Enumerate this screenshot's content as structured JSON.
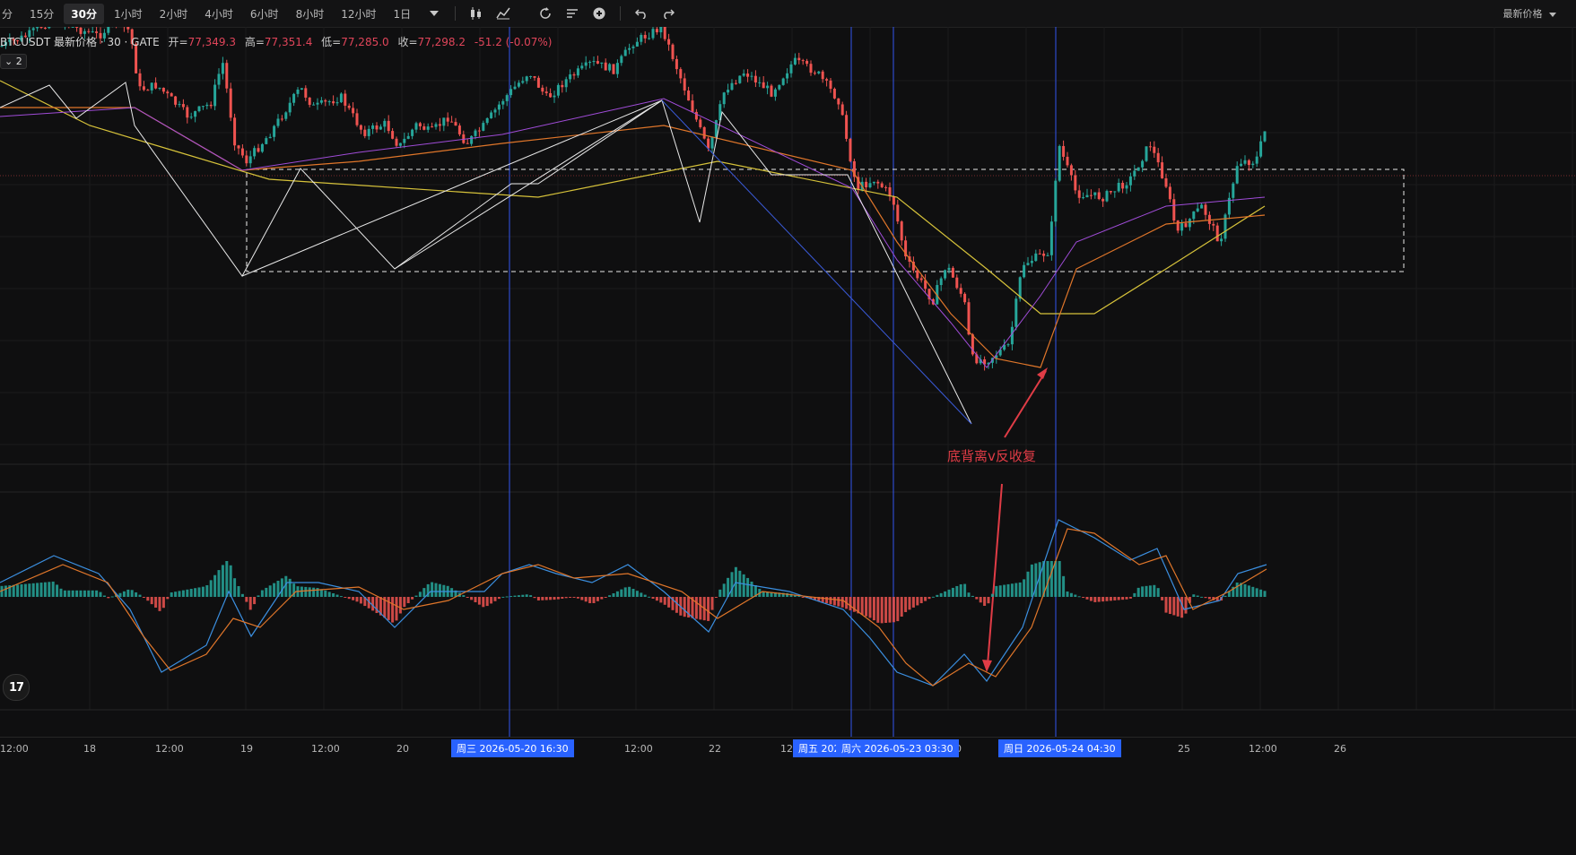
{
  "toolbar": {
    "timeframes": [
      "分",
      "15分",
      "30分",
      "1小时",
      "2小时",
      "4小时",
      "6小时",
      "8小时",
      "12小时",
      "1日"
    ],
    "active": "30分",
    "icons": [
      "chevron-down-icon",
      "candles-icon",
      "indicators-icon",
      "replay-icon",
      "alert-icon",
      "add-icon",
      "undo-icon",
      "redo-icon"
    ],
    "price_mode": "最新价格"
  },
  "legend": {
    "symbol": "BTCUSDT 最新价格 · 30 · GATE",
    "open_label": "开=",
    "open": "77,349.3",
    "high_label": "高=",
    "high": "77,351.4",
    "low_label": "低=",
    "low": "77,285.0",
    "close_label": "收=",
    "close": "77,298.2",
    "change": "-51.2 (-0.07%)",
    "collapse": "2"
  },
  "annotation": {
    "text": "底背离v反收复",
    "color": "#e03c46"
  },
  "time_axis": {
    "ticks": [
      "12:00",
      "18",
      "12:00",
      "19",
      "12:00",
      "20",
      "12:00",
      "22",
      "12",
      "00",
      "25",
      "12:00",
      "26"
    ],
    "highlights": [
      "周三 2026-05-20   16:30",
      "周五 202",
      "周六 2026-05-23   03:30",
      "周日 2026-05-24   04:30"
    ]
  },
  "colors": {
    "up": "#26a69a",
    "down": "#ef5350",
    "vline": "#3355ee",
    "ma_fast": "#a04cd8",
    "ma_mid": "#e0762a",
    "ma_slow": "#d6c23a",
    "macd": "#3b8fe0",
    "signal": "#e0762a"
  },
  "chart_data": {
    "type": "candlestick",
    "price_path": [
      [
        0,
        52
      ],
      [
        30,
        40
      ],
      [
        60,
        20
      ],
      [
        80,
        30
      ],
      [
        110,
        40
      ],
      [
        130,
        22
      ],
      [
        145,
        35
      ],
      [
        155,
        100
      ],
      [
        175,
        95
      ],
      [
        210,
        130
      ],
      [
        235,
        115
      ],
      [
        248,
        68
      ],
      [
        262,
        160
      ],
      [
        275,
        180
      ],
      [
        300,
        150
      ],
      [
        335,
        98
      ],
      [
        350,
        120
      ],
      [
        380,
        108
      ],
      [
        405,
        148
      ],
      [
        430,
        138
      ],
      [
        445,
        164
      ],
      [
        465,
        138
      ],
      [
        480,
        148
      ],
      [
        500,
        130
      ],
      [
        520,
        160
      ],
      [
        540,
        140
      ],
      [
        560,
        112
      ],
      [
        590,
        80
      ],
      [
        610,
        110
      ],
      [
        630,
        90
      ],
      [
        660,
        70
      ],
      [
        685,
        78
      ],
      [
        705,
        48
      ],
      [
        738,
        30
      ],
      [
        745,
        50
      ],
      [
        760,
        90
      ],
      [
        790,
        170
      ],
      [
        808,
        100
      ],
      [
        830,
        80
      ],
      [
        860,
        103
      ],
      [
        885,
        68
      ],
      [
        910,
        80
      ],
      [
        935,
        112
      ],
      [
        955,
        210
      ],
      [
        975,
        200
      ],
      [
        995,
        220
      ],
      [
        1010,
        290
      ],
      [
        1030,
        320
      ],
      [
        1040,
        336
      ],
      [
        1055,
        295
      ],
      [
        1075,
        335
      ],
      [
        1083,
        400
      ],
      [
        1100,
        402
      ],
      [
        1125,
        385
      ],
      [
        1140,
        295
      ],
      [
        1170,
        280
      ],
      [
        1180,
        160
      ],
      [
        1200,
        216
      ],
      [
        1230,
        220
      ],
      [
        1260,
        200
      ],
      [
        1282,
        160
      ],
      [
        1300,
        206
      ],
      [
        1312,
        260
      ],
      [
        1340,
        230
      ],
      [
        1360,
        270
      ],
      [
        1380,
        180
      ],
      [
        1400,
        180
      ],
      [
        1412,
        140
      ]
    ],
    "ma_fast": [
      [
        0,
        100
      ],
      [
        150,
        90
      ],
      [
        270,
        160
      ],
      [
        400,
        140
      ],
      [
        560,
        120
      ],
      [
        740,
        80
      ],
      [
        950,
        180
      ],
      [
        1000,
        260
      ],
      [
        1060,
        330
      ],
      [
        1100,
        380
      ],
      [
        1160,
        300
      ],
      [
        1200,
        240
      ],
      [
        1300,
        200
      ],
      [
        1410,
        190
      ]
    ],
    "ma_mid": [
      [
        0,
        90
      ],
      [
        150,
        90
      ],
      [
        270,
        160
      ],
      [
        400,
        150
      ],
      [
        560,
        130
      ],
      [
        740,
        110
      ],
      [
        950,
        160
      ],
      [
        1000,
        240
      ],
      [
        1060,
        320
      ],
      [
        1110,
        370
      ],
      [
        1160,
        380
      ],
      [
        1200,
        270
      ],
      [
        1300,
        220
      ],
      [
        1410,
        210
      ]
    ],
    "ma_slow": [
      [
        0,
        60
      ],
      [
        100,
        110
      ],
      [
        200,
        140
      ],
      [
        300,
        170
      ],
      [
        600,
        190
      ],
      [
        800,
        150
      ],
      [
        1000,
        190
      ],
      [
        1100,
        270
      ],
      [
        1160,
        320
      ],
      [
        1220,
        320
      ],
      [
        1300,
        270
      ],
      [
        1410,
        200
      ]
    ],
    "macd_line": [
      [
        0,
        650
      ],
      [
        60,
        620
      ],
      [
        110,
        640
      ],
      [
        145,
        680
      ],
      [
        180,
        750
      ],
      [
        230,
        720
      ],
      [
        255,
        660
      ],
      [
        280,
        710
      ],
      [
        320,
        650
      ],
      [
        355,
        650
      ],
      [
        400,
        660
      ],
      [
        440,
        700
      ],
      [
        480,
        660
      ],
      [
        540,
        660
      ],
      [
        560,
        640
      ],
      [
        590,
        630
      ],
      [
        620,
        640
      ],
      [
        660,
        650
      ],
      [
        700,
        630
      ],
      [
        740,
        660
      ],
      [
        790,
        705
      ],
      [
        820,
        650
      ],
      [
        880,
        660
      ],
      [
        940,
        680
      ],
      [
        970,
        712
      ],
      [
        1000,
        750
      ],
      [
        1040,
        765
      ],
      [
        1075,
        730
      ],
      [
        1100,
        760
      ],
      [
        1140,
        700
      ],
      [
        1180,
        580
      ],
      [
        1220,
        600
      ],
      [
        1260,
        625
      ],
      [
        1290,
        612
      ],
      [
        1320,
        680
      ],
      [
        1360,
        670
      ],
      [
        1380,
        640
      ],
      [
        1412,
        630
      ]
    ],
    "signal_line": [
      [
        0,
        660
      ],
      [
        70,
        630
      ],
      [
        120,
        650
      ],
      [
        160,
        710
      ],
      [
        190,
        748
      ],
      [
        230,
        730
      ],
      [
        260,
        690
      ],
      [
        290,
        700
      ],
      [
        330,
        660
      ],
      [
        400,
        655
      ],
      [
        450,
        680
      ],
      [
        500,
        670
      ],
      [
        560,
        640
      ],
      [
        600,
        630
      ],
      [
        640,
        645
      ],
      [
        700,
        640
      ],
      [
        760,
        660
      ],
      [
        800,
        690
      ],
      [
        850,
        660
      ],
      [
        940,
        670
      ],
      [
        980,
        700
      ],
      [
        1010,
        740
      ],
      [
        1040,
        765
      ],
      [
        1080,
        740
      ],
      [
        1110,
        755
      ],
      [
        1150,
        700
      ],
      [
        1190,
        590
      ],
      [
        1220,
        595
      ],
      [
        1270,
        630
      ],
      [
        1300,
        620
      ],
      [
        1330,
        680
      ],
      [
        1370,
        660
      ],
      [
        1412,
        635
      ]
    ],
    "vertical_dates": [
      "2026-05-20 16:30",
      "周五",
      "2026-05-23 03:30",
      "2026-05-24 04:30"
    ]
  }
}
